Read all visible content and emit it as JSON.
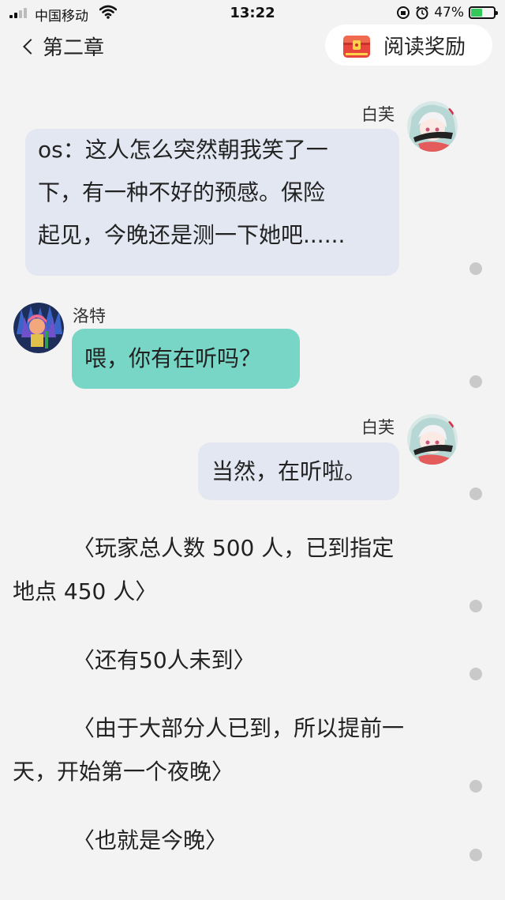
{
  "status_bar": {
    "carrier": "中国移动",
    "time": "13:22",
    "battery": "47%"
  },
  "nav": {
    "back_label": "第二章",
    "reward_label": "阅读奖励"
  },
  "messages": [
    {
      "speaker": "白芙",
      "lines": [
        "os：这人怎么突然朝我笑了一",
        "下，有一种不好的预感。保险",
        "起见，今晚还是测一下她吧......"
      ]
    },
    {
      "speaker": "洛特",
      "lines": [
        "喂，你有在听吗？"
      ]
    },
    {
      "speaker": "白芙",
      "lines": [
        "当然，在听啦。"
      ]
    }
  ],
  "narration": [
    {
      "lines": [
        "〈玩家总人数 500 人，已到指定",
        "地点 450 人〉"
      ]
    },
    {
      "lines": [
        "〈还有50人未到〉"
      ]
    },
    {
      "lines": [
        "〈由于大部分人已到，所以提前一",
        "天，开始第一个夜晚〉"
      ]
    },
    {
      "lines": [
        "〈也就是今晚〉"
      ]
    }
  ],
  "colors": {
    "background": "#f3f3f3",
    "bubble_self": "#e3e7f2",
    "bubble_other": "#78d6c6",
    "comment_dot": "#c9c9c9"
  },
  "icons": [
    "signal-icon",
    "wifi-icon",
    "orientation-lock-icon",
    "alarm-icon",
    "battery-icon",
    "back-chevron-icon",
    "treasure-chest-icon",
    "avatar-baifu",
    "avatar-luote",
    "comment-dot-icon"
  ]
}
